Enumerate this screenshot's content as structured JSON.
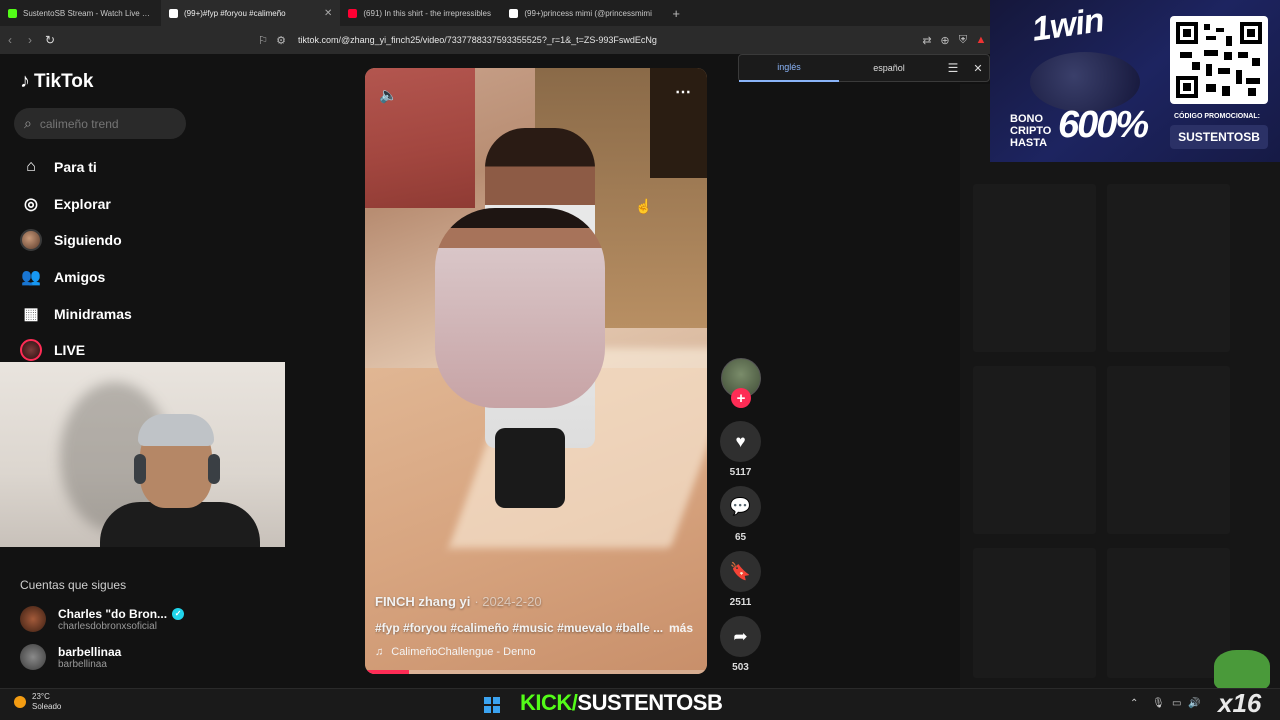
{
  "browser": {
    "tabs": [
      {
        "title": "SustentoSB Stream - Watch Live on K",
        "color": "#53fc18",
        "active": false
      },
      {
        "title": "(99+)#fyp #foryou #calimeño",
        "color": "#ffffff",
        "active": true
      },
      {
        "title": "(691) In this shirt - the irrepressibles",
        "color": "#ff0033",
        "active": false
      },
      {
        "title": "(99+)princess mimi (@princessmimi",
        "color": "#ffffff",
        "active": false
      }
    ],
    "new_tab": "+",
    "url": "tiktok.com/@zhang_yi_finch25/video/7337788337593355525?_r=1&_t=ZS-993FswdEcNg"
  },
  "translate_popup": {
    "source": "inglés",
    "target": "español"
  },
  "tiktok": {
    "logo": "TikTok",
    "search_placeholder": "calimeño trend",
    "nav": [
      {
        "label": "Para ti",
        "icon": "home-icon"
      },
      {
        "label": "Explorar",
        "icon": "compass-icon"
      },
      {
        "label": "Siguiendo",
        "icon": "avatar"
      },
      {
        "label": "Amigos",
        "icon": "friends-icon"
      },
      {
        "label": "Minidramas",
        "icon": "film-icon"
      },
      {
        "label": "LIVE",
        "icon": "live-icon"
      }
    ],
    "following_title": "Cuentas que sigues",
    "following": [
      {
        "name": "Charles \"do Bron...",
        "handle": "charlesdobronxsoficial",
        "verified": true
      },
      {
        "name": "barbellinaa",
        "handle": "barbellinaa",
        "verified": false
      }
    ]
  },
  "video": {
    "author": "FINCH zhang yi",
    "date": "· 2024-2-20",
    "caption": "#fyp #foryou #calimeño #music #muevalo #balle ...",
    "more": "más",
    "music": "CalimeñoChallengue - Denno",
    "progress": 0.13
  },
  "actions": {
    "likes": "5117",
    "comments": "65",
    "saves": "2511",
    "shares": "503"
  },
  "ad": {
    "brand": "1win",
    "bono_line1": "BONO",
    "bono_line2": "CRIPTO",
    "bono_line3": "HASTA",
    "percent": "600%",
    "code_label": "CÓDIGO PROMOCIONAL:",
    "code": "SUSTENTOSB"
  },
  "taskbar": {
    "temp": "23°C",
    "weather": "Soleado",
    "kick_prefix": "KICK/",
    "kick_name": "SUSTENTOSB",
    "watermark": "x16"
  }
}
